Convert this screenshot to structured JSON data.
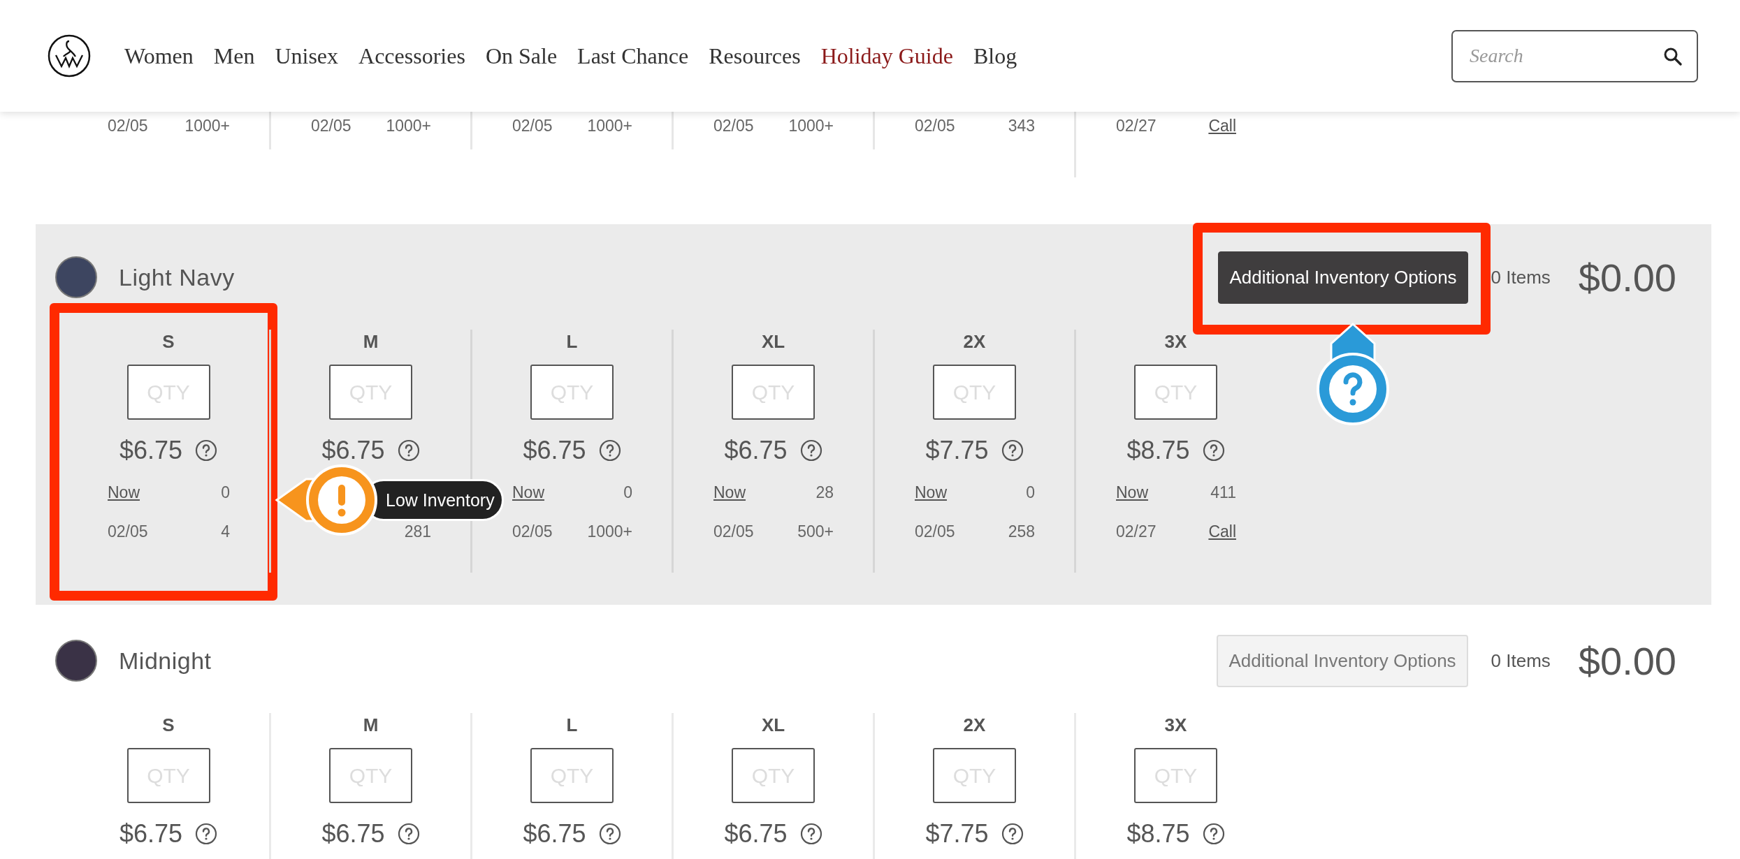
{
  "header": {
    "nav": [
      {
        "label": "Women",
        "highlighted": false
      },
      {
        "label": "Men",
        "highlighted": false
      },
      {
        "label": "Unisex",
        "highlighted": false
      },
      {
        "label": "Accessories",
        "highlighted": false
      },
      {
        "label": "On Sale",
        "highlighted": false
      },
      {
        "label": "Last Chance",
        "highlighted": false
      },
      {
        "label": "Resources",
        "highlighted": false
      },
      {
        "label": "Holiday Guide",
        "highlighted": true
      },
      {
        "label": "Blog",
        "highlighted": false
      }
    ],
    "search": {
      "placeholder": "Search"
    }
  },
  "partial_section": {
    "sizes": [
      {
        "date": "02/05",
        "future_qty": "1000+",
        "future_is_link": false
      },
      {
        "date": "02/05",
        "future_qty": "1000+",
        "future_is_link": false
      },
      {
        "date": "02/05",
        "future_qty": "1000+",
        "future_is_link": false
      },
      {
        "date": "02/05",
        "future_qty": "1000+",
        "future_is_link": false
      },
      {
        "date": "02/05",
        "future_qty": "343",
        "future_is_link": false
      },
      {
        "date": "02/27",
        "future_qty": "Call",
        "future_is_link": true
      }
    ]
  },
  "sections": [
    {
      "name": "Light Navy",
      "color": "#3d4560",
      "shaded": true,
      "button": {
        "label": "Additional Inventory Options",
        "highlighted": true,
        "framed": true,
        "callout": {
          "kind": "help"
        }
      },
      "items_count": "0 Items",
      "total": "$0.00",
      "sizes": [
        {
          "size": "S",
          "qty_placeholder": "QTY",
          "price": "$6.75",
          "now_label": "Now",
          "now_qty": "0",
          "date": "02/05",
          "future_qty": "4",
          "future_is_link": false,
          "framed": true,
          "callout": {
            "kind": "warning",
            "label": "Low Inventory"
          }
        },
        {
          "size": "M",
          "qty_placeholder": "QTY",
          "price": "$6.75",
          "future_qty": "281",
          "future_is_link": false,
          "framed": false
        },
        {
          "size": "L",
          "qty_placeholder": "QTY",
          "price": "$6.75",
          "now_label": "Now",
          "now_qty": "0",
          "date": "02/05",
          "future_qty": "1000+",
          "future_is_link": false,
          "framed": false
        },
        {
          "size": "XL",
          "qty_placeholder": "QTY",
          "price": "$6.75",
          "now_label": "Now",
          "now_qty": "28",
          "date": "02/05",
          "future_qty": "500+",
          "future_is_link": false,
          "framed": false
        },
        {
          "size": "2X",
          "qty_placeholder": "QTY",
          "price": "$7.75",
          "now_label": "Now",
          "now_qty": "0",
          "date": "02/05",
          "future_qty": "258",
          "future_is_link": false,
          "framed": false
        },
        {
          "size": "3X",
          "qty_placeholder": "QTY",
          "price": "$8.75",
          "now_label": "Now",
          "now_qty": "411",
          "date": "02/27",
          "future_qty": "Call",
          "future_is_link": true,
          "framed": false
        }
      ]
    },
    {
      "name": "Midnight",
      "color": "#3a3246",
      "shaded": false,
      "button": {
        "label": "Additional Inventory Options",
        "highlighted": false
      },
      "items_count": "0 Items",
      "total": "$0.00",
      "sizes": [
        {
          "size": "S",
          "qty_placeholder": "QTY",
          "price": "$6.75",
          "framed": false
        },
        {
          "size": "M",
          "qty_placeholder": "QTY",
          "price": "$6.75",
          "framed": false
        },
        {
          "size": "L",
          "qty_placeholder": "QTY",
          "price": "$6.75",
          "framed": false
        },
        {
          "size": "XL",
          "qty_placeholder": "QTY",
          "price": "$6.75",
          "framed": false
        },
        {
          "size": "2X",
          "qty_placeholder": "QTY",
          "price": "$7.75",
          "framed": false
        },
        {
          "size": "3X",
          "qty_placeholder": "QTY",
          "price": "$8.75",
          "framed": false
        }
      ]
    }
  ]
}
